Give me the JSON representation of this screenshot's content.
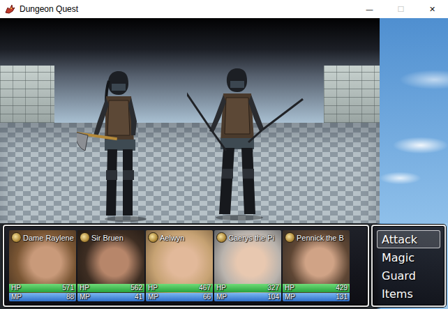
{
  "window": {
    "title": "Dungeon Quest",
    "controls": [
      {
        "label": "—",
        "disabled": false
      },
      {
        "label": "☐",
        "disabled": true
      },
      {
        "label": "✕",
        "disabled": false
      }
    ]
  },
  "party": {
    "hp_label": "HP",
    "mp_label": "MP",
    "members": [
      {
        "name": "Dame Raylene",
        "hp": "571",
        "mp": "88",
        "hp_level": 1,
        "mp_level": 1
      },
      {
        "name": "Sir Bruen",
        "hp": "562",
        "mp": "41",
        "hp_level": 1,
        "mp_level": 1
      },
      {
        "name": "Aelwyn",
        "hp": "467",
        "mp": "66",
        "hp_level": 1,
        "mp_level": 1
      },
      {
        "name": "Caerys the Pi",
        "hp": "327",
        "mp": "104",
        "hp_level": 1,
        "mp_level": 1
      },
      {
        "name": "Pennick the B",
        "hp": "429",
        "mp": "131",
        "hp_level": 1,
        "mp_level": 1
      }
    ]
  },
  "commands": [
    {
      "label": "Attack",
      "selected": true
    },
    {
      "label": "Magic",
      "selected": false
    },
    {
      "label": "Guard",
      "selected": false
    },
    {
      "label": "Items",
      "selected": false
    }
  ]
}
